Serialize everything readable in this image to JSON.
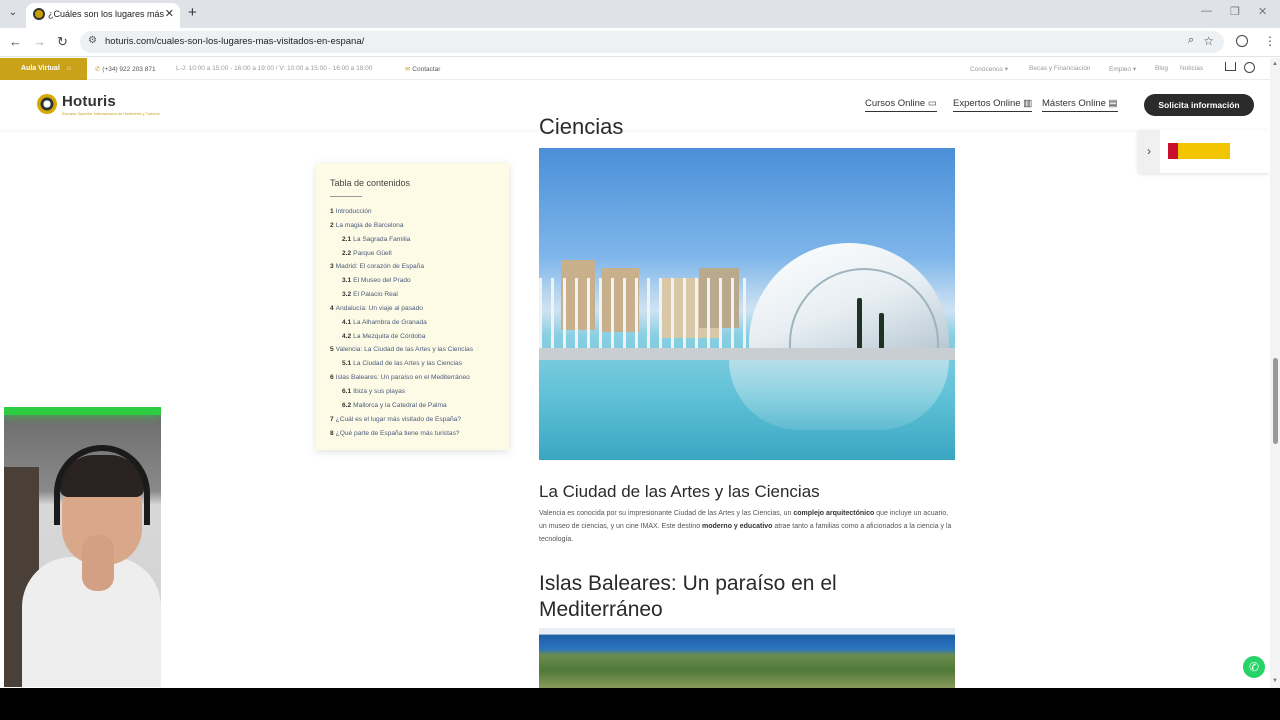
{
  "browser": {
    "tab_title": "¿Cuáles son los lugares más visitados en España?",
    "new_tab": "+",
    "close_tab": "✕",
    "url": "hoturis.com/cuales-son-los-lugares-mas-visitados-en-espana/"
  },
  "topbar": {
    "aula_virtual": "Aula Virtual",
    "phone": "(+34) 922 203 871",
    "hours": "L-J: 10:00 a 15:00 - 16:00 a 19:00 / V: 10:00 a 15:00 - 16:00 a 18:00",
    "contact": "Contactar",
    "links": [
      "Conócenos",
      "Becas y Financiación",
      "Empleo",
      "Blog",
      "Noticias"
    ]
  },
  "header": {
    "logo": "Hoturis",
    "logo_sub": "Escuela Superior Internacional de Hostelería y Turismo",
    "menu": [
      "Cursos Online",
      "Expertos Online",
      "Másters Online"
    ],
    "cta": "Solicita información"
  },
  "content": {
    "heading_top": "Ciencias",
    "section1_title": "La Ciudad de las Artes y las Ciencias",
    "section1_text_a": "Valencia es conocida por su impresionante Ciudad de las Artes y las Ciencias, un ",
    "section1_bold_a": "complejo arquitectónico",
    "section1_text_b": " que incluye un acuario, un museo de ciencias, y un cine IMAX. Este destino ",
    "section1_bold_b": "moderno y educativo",
    "section1_text_c": " atrae tanto a familias como a aficionados a la ciencia y la tecnología.",
    "section2_title": "Islas Baleares: Un paraíso en el Mediterráneo"
  },
  "toc": {
    "title": "Tabla de contenidos",
    "items": [
      {
        "num": "1",
        "label": "Introducción",
        "sub": false
      },
      {
        "num": "2",
        "label": "La magia de Barcelona",
        "sub": false
      },
      {
        "num": "2.1",
        "label": "La Sagrada Familia",
        "sub": true
      },
      {
        "num": "2.2",
        "label": "Parque Güell",
        "sub": true
      },
      {
        "num": "3",
        "label": "Madrid: El corazón de España",
        "sub": false
      },
      {
        "num": "3.1",
        "label": "El Museo del Prado",
        "sub": true
      },
      {
        "num": "3.2",
        "label": "El Palacio Real",
        "sub": true
      },
      {
        "num": "4",
        "label": "Andalucía: Un viaje al pasado",
        "sub": false
      },
      {
        "num": "4.1",
        "label": "La Alhambra de Granada",
        "sub": true
      },
      {
        "num": "4.2",
        "label": "La Mezquita de Córdoba",
        "sub": true
      },
      {
        "num": "5",
        "label": "Valencia: La Ciudad de las Artes y las Ciencias",
        "sub": false
      },
      {
        "num": "5.1",
        "label": "La Ciudad de las Artes y las Ciencias",
        "sub": true
      },
      {
        "num": "6",
        "label": "Islas Baleares: Un paraíso en el Mediterráneo",
        "sub": false
      },
      {
        "num": "6.1",
        "label": "Ibiza y sus playas",
        "sub": true
      },
      {
        "num": "6.2",
        "label": "Mallorca y la Catedral de Palma",
        "sub": true
      },
      {
        "num": "7",
        "label": "¿Cuál es el lugar más visitado de España?",
        "sub": false
      },
      {
        "num": "8",
        "label": "¿Qué parte de España tiene más turistas?",
        "sub": false
      }
    ]
  },
  "colors": {
    "brand_gold": "#c9a21a",
    "cta_dark": "#2b2b2b",
    "toc_bg": "#fdfbe6",
    "whatsapp": "#25d366"
  }
}
